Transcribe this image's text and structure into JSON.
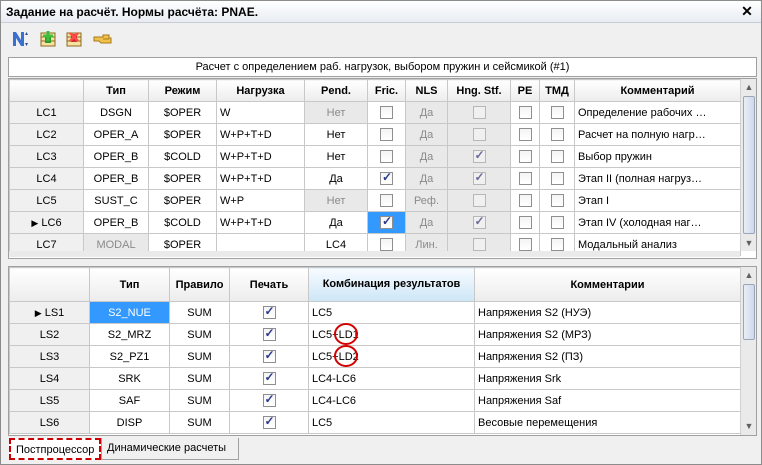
{
  "window": {
    "title": "Задание на расчёт. Нормы расчёта: PNAE.",
    "close_glyph": "✕"
  },
  "toolbar": {
    "icons": [
      "sort-icon",
      "add-row-icon",
      "delete-row-icon",
      "pointer-icon"
    ]
  },
  "caption": "Расчет с определением раб. нагрузок, выбором пружин и сейсмикой (#1)",
  "top_table": {
    "headers": [
      "Тип",
      "Режим",
      "Нагрузка",
      "Pend.",
      "Fric.",
      "NLS",
      "Hng. Stf.",
      "PE",
      "ТМД",
      "Комментарий"
    ],
    "rows": [
      {
        "id": "LC1",
        "type": "DSGN",
        "mode": "$OPER",
        "load": "W",
        "pend": "Нет",
        "fric": false,
        "nls": "Да",
        "hng": false,
        "pe": false,
        "tmd": false,
        "comment": "Определение рабочих …"
      },
      {
        "id": "LC2",
        "type": "OPER_A",
        "mode": "$OPER",
        "load": "W+P+T+D",
        "pend": "Нет",
        "fric": false,
        "nls": "Да",
        "hng": false,
        "pe": false,
        "tmd": false,
        "comment": "Расчет на полную нагр…"
      },
      {
        "id": "LC3",
        "type": "OPER_B",
        "mode": "$COLD",
        "load": "W+P+T+D",
        "pend": "Нет",
        "fric": false,
        "nls": "Да",
        "hng": true,
        "pe": false,
        "tmd": false,
        "comment": "Выбор пружин"
      },
      {
        "id": "LC4",
        "type": "OPER_B",
        "mode": "$OPER",
        "load": "W+P+T+D",
        "pend": "Да",
        "fric": true,
        "nls": "Да",
        "hng": true,
        "pe": false,
        "tmd": false,
        "comment": "Этап II (полная нагруз…"
      },
      {
        "id": "LC5",
        "type": "SUST_C",
        "mode": "$OPER",
        "load": "W+P",
        "pend": "Нет",
        "fric": false,
        "nls": "Реф.",
        "hng": false,
        "pe": false,
        "tmd": false,
        "comment": "Этап I"
      },
      {
        "id": "LC6",
        "type": "OPER_B",
        "mode": "$COLD",
        "load": "W+P+T+D",
        "pend": "Да",
        "fric": true,
        "nls": "Да",
        "hng": true,
        "pe": false,
        "tmd": false,
        "comment": "Этап IV (холодная наг…"
      },
      {
        "id": "LC7",
        "type": "MODAL",
        "mode": "$OPER",
        "load": "",
        "pend": "LC4",
        "fric": false,
        "nls": "Лин.",
        "hng": false,
        "pe": false,
        "tmd": false,
        "comment": "Модальный анализ"
      }
    ]
  },
  "bottom_table": {
    "headers": [
      "Тип",
      "Правило",
      "Печать",
      "Комбинация результатов",
      "Комментарии"
    ],
    "rows": [
      {
        "id": "LS1",
        "type": "S2_NUE",
        "rule": "SUM",
        "print": true,
        "combo": "LC5",
        "comment": "Напряжения S2 (НУЭ)"
      },
      {
        "id": "LS2",
        "type": "S2_MRZ",
        "rule": "SUM",
        "print": true,
        "combo": "LC5+LD1",
        "comment": "Напряжения S2 (МРЗ)"
      },
      {
        "id": "LS3",
        "type": "S2_PZ1",
        "rule": "SUM",
        "print": true,
        "combo": "LC5+LD2",
        "comment": "Напряжения S2 (ПЗ)"
      },
      {
        "id": "LS4",
        "type": "SRK",
        "rule": "SUM",
        "print": true,
        "combo": "LC4-LC6",
        "comment": "Напряжения Srk"
      },
      {
        "id": "LS5",
        "type": "SAF",
        "rule": "SUM",
        "print": true,
        "combo": "LC4-LC6",
        "comment": "Напряжения Saf"
      },
      {
        "id": "LS6",
        "type": "DISP",
        "rule": "SUM",
        "print": true,
        "combo": "LC5",
        "comment": "Весовые перемещения"
      }
    ]
  },
  "tabs": [
    {
      "label": "Постпроцессор",
      "active": true
    },
    {
      "label": "Динамические расчеты",
      "active": false
    }
  ]
}
